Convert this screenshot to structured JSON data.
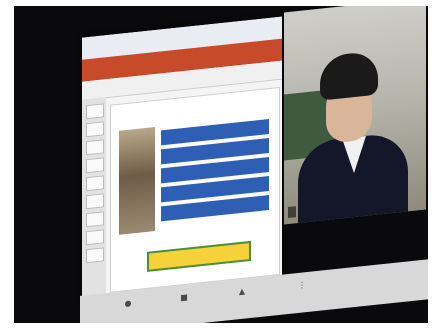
{
  "scene": {
    "browser_tab_text": "",
    "slide": {
      "title": "",
      "boxes": [
        "",
        "",
        "",
        "",
        ""
      ],
      "banner": ""
    },
    "participant": {
      "name_tag": ""
    },
    "control_bar": {
      "labels": [
        "",
        "",
        "",
        ""
      ]
    }
  },
  "icons": [
    "microphone-icon",
    "camera-icon",
    "share-icon",
    "more-icon"
  ]
}
